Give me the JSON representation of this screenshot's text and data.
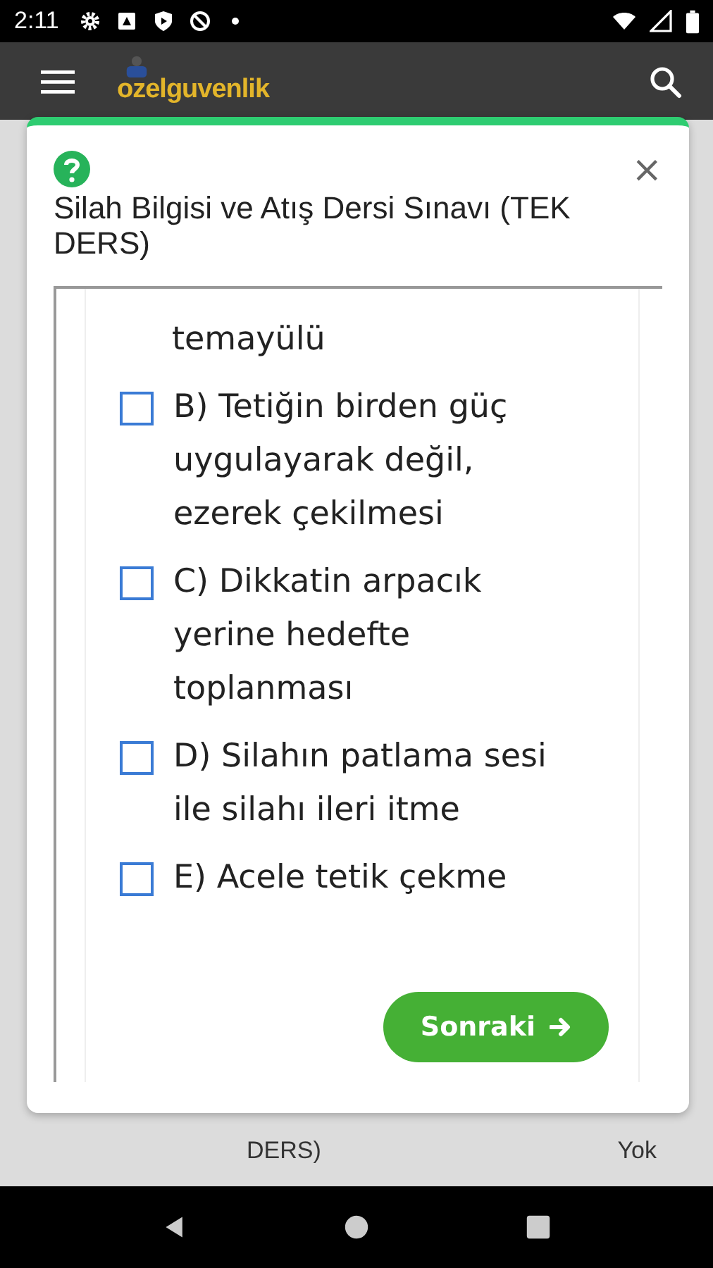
{
  "status_bar": {
    "time": "2:11"
  },
  "app_bar": {
    "logo": "ozelguvenlik"
  },
  "background_table": {
    "cells": [
      {
        "text": "DERS)"
      },
      {
        "text": "Yok"
      }
    ]
  },
  "dialog": {
    "title": "Silah Bilgisi ve Atış Dersi Sınavı (TEK DERS)",
    "close": "×",
    "question_tail": "temayülü",
    "options": [
      {
        "text": "B) Tetiğin birden güç uygulayarak değil, ezerek çekilmesi",
        "checked": false
      },
      {
        "text": "C) Dikkatin arpacık yerine hedefte toplanması",
        "checked": false
      },
      {
        "text": "D) Silahın patlama sesi ile silahı ileri itme",
        "checked": false
      },
      {
        "text": "E) Acele tetik çekme",
        "checked": false
      }
    ],
    "next_button": "Sonraki"
  }
}
